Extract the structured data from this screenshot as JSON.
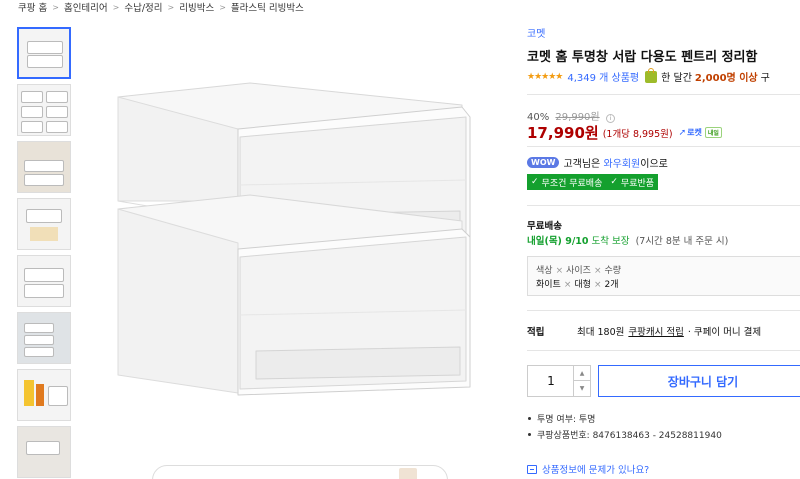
{
  "breadcrumb": [
    "쿠팡 홈",
    "홈인테리어",
    "수납/정리",
    "리빙박스",
    "플라스틱 리빙박스"
  ],
  "product": {
    "brand": "코멧",
    "title": "코멧 홈 투명창 서랍 다용도 펜트리 정리함",
    "stars": "★★★★★",
    "review_count": "4,349 개 상품평",
    "sold_prefix": "한 달간",
    "sold_qty": "2,000명 이상",
    "sold_suffix": "구"
  },
  "price": {
    "discount": "40%",
    "original": "29,990원",
    "sale": "17,990원",
    "unit_price": "(1개당 8,995원)",
    "rocket_label": "로켓",
    "rocket_tag": "내일"
  },
  "wow": {
    "badge": "WOW",
    "text_prefix": "고객님은",
    "member": "와우회원",
    "text_suffix": "이으로"
  },
  "benefits": [
    "무조건 무료배송",
    "무료반품"
  ],
  "shipping": {
    "label": "무료배송",
    "date": "내일(목) 9/10",
    "guarantee": "도착 보장",
    "deadline": "(7시간 8분 내 주문 시)"
  },
  "options": {
    "labels": [
      "색상",
      "사이즈",
      "수량"
    ],
    "values": [
      "화이트",
      "대형",
      "2개"
    ]
  },
  "reward": {
    "label": "적립",
    "max": "최대 180원",
    "cash": "쿠팡캐시 적립",
    "pay": "· 쿠페이 머니 결제"
  },
  "cart": {
    "quantity": "1",
    "add_to_cart": "장바구니 담기"
  },
  "specs": [
    "투명 여부: 투명",
    "쿠팡상품번호: 8476138463 - 24528811940"
  ],
  "report": "상품정보에 문제가 있나요?",
  "colors": {
    "accent": "#346aff",
    "price": "#ae0000",
    "green": "#14a02e"
  }
}
